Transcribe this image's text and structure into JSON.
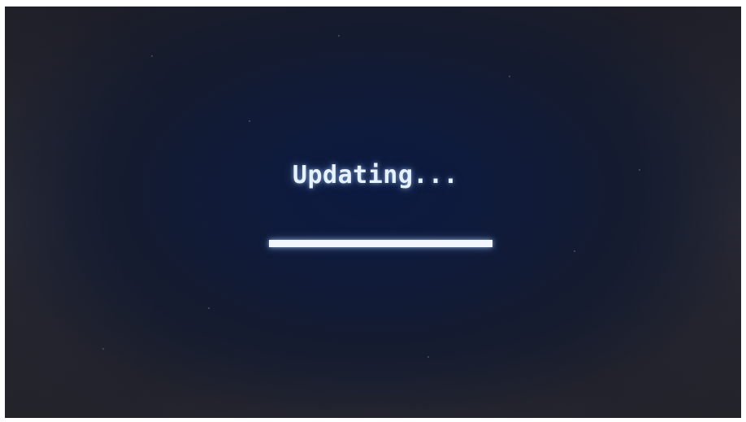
{
  "screen": {
    "status_text": "Updating...",
    "progress_fraction": 1.0
  },
  "colors": {
    "screen_background": "#101b3a",
    "text": "#e6f2ff",
    "progress_fill": "#f2f7ff"
  }
}
